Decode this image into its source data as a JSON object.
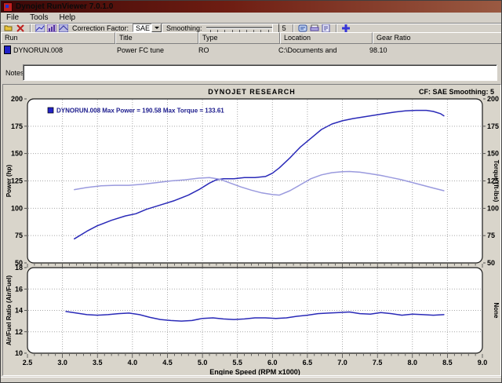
{
  "window": {
    "title": "Dynojet RunViewer 7.0.1.0"
  },
  "menu": {
    "items": [
      "File",
      "Tools",
      "Help"
    ]
  },
  "toolbar": {
    "correction_factor_label": "Correction Factor:",
    "correction_factor_value": "SAE",
    "smoothing_label": "Smoothing:",
    "smoothing_value": "5",
    "icons": [
      "open-run-icon",
      "close-run-icon",
      "graph-power-icon",
      "graph-overlay-icon",
      "graph-setup-icon",
      "notes-icon",
      "print-icon",
      "report-icon",
      "overlay-add-icon"
    ]
  },
  "run_table": {
    "columns": [
      "Run",
      "Title",
      "Type",
      "Location",
      "Gear Ratio"
    ],
    "rows": [
      {
        "run": "DYNORUN.008",
        "title": "Power FC tune",
        "type": "RO",
        "location": "C:\\Documents and",
        "gear_ratio": "98.10"
      }
    ]
  },
  "notes": {
    "label": "Notes:",
    "value": ""
  },
  "chart": {
    "header_center": "DYNOJET RESEARCH",
    "header_right": "CF: SAE  Smoothing: 5",
    "legend": {
      "swatch_color": "#2222c8",
      "text": "DYNORUN.008 Max Power = 190.58 Max Torque = 133.61"
    }
  },
  "colors": {
    "power_curve": "#2a2ab8",
    "torque_curve": "#9a9ade",
    "afr_curve": "#2a2ab8",
    "grid": "#a8a8a8",
    "legend_text": "#1a1a8c"
  },
  "chart_data": [
    {
      "type": "line",
      "title": "DYNOJET RESEARCH",
      "xlabel": "Engine Speed (RPM x1000)",
      "ylabel_left": "Power (hp)",
      "ylabel_right": "Torque (ft-lbs)",
      "xlim": [
        2.5,
        9.0
      ],
      "ylim": [
        50,
        200
      ],
      "xticks": [
        2.5,
        3.0,
        3.5,
        4.0,
        4.5,
        5.0,
        5.5,
        6.0,
        6.5,
        7.0,
        7.5,
        8.0,
        8.5,
        9.0
      ],
      "yticks": [
        50,
        75,
        100,
        125,
        150,
        175,
        200
      ],
      "grid": true,
      "legend_position": "top-left",
      "annotations": [
        "DYNORUN.008 Max Power = 190.58 Max Torque = 133.61"
      ],
      "series": [
        {
          "name": "Power (hp)",
          "color": "#2a2ab8",
          "points": [
            [
              3.17,
              72
            ],
            [
              3.35,
              79
            ],
            [
              3.5,
              84
            ],
            [
              3.7,
              89
            ],
            [
              3.9,
              93
            ],
            [
              4.05,
              95
            ],
            [
              4.2,
              99
            ],
            [
              4.4,
              103
            ],
            [
              4.6,
              107
            ],
            [
              4.8,
              112
            ],
            [
              4.95,
              117
            ],
            [
              5.1,
              123
            ],
            [
              5.2,
              126
            ],
            [
              5.3,
              127
            ],
            [
              5.45,
              127
            ],
            [
              5.6,
              128
            ],
            [
              5.75,
              128
            ],
            [
              5.9,
              129
            ],
            [
              6.0,
              132
            ],
            [
              6.1,
              137
            ],
            [
              6.25,
              146
            ],
            [
              6.4,
              156
            ],
            [
              6.55,
              164
            ],
            [
              6.7,
              172
            ],
            [
              6.85,
              177
            ],
            [
              7.0,
              180
            ],
            [
              7.15,
              182
            ],
            [
              7.3,
              183.5
            ],
            [
              7.45,
              185
            ],
            [
              7.6,
              186.5
            ],
            [
              7.75,
              188
            ],
            [
              7.9,
              189
            ],
            [
              8.05,
              189.5
            ],
            [
              8.2,
              189.5
            ],
            [
              8.3,
              188.5
            ],
            [
              8.4,
              186.5
            ],
            [
              8.45,
              184.5
            ]
          ]
        },
        {
          "name": "Torque (ft-lbs)",
          "color": "#9a9ade",
          "points": [
            [
              3.17,
              117
            ],
            [
              3.35,
              119
            ],
            [
              3.55,
              120.5
            ],
            [
              3.75,
              121
            ],
            [
              3.95,
              121
            ],
            [
              4.15,
              122
            ],
            [
              4.35,
              123.5
            ],
            [
              4.55,
              125
            ],
            [
              4.75,
              126
            ],
            [
              4.95,
              127.5
            ],
            [
              5.1,
              128
            ],
            [
              5.25,
              126.5
            ],
            [
              5.4,
              123
            ],
            [
              5.55,
              119.5
            ],
            [
              5.7,
              116.5
            ],
            [
              5.85,
              114
            ],
            [
              6.0,
              112.5
            ],
            [
              6.1,
              112
            ],
            [
              6.25,
              116
            ],
            [
              6.4,
              121.5
            ],
            [
              6.55,
              127
            ],
            [
              6.7,
              130.5
            ],
            [
              6.85,
              132.5
            ],
            [
              7.0,
              133.5
            ],
            [
              7.1,
              133.6
            ],
            [
              7.25,
              133
            ],
            [
              7.4,
              131.5
            ],
            [
              7.55,
              130
            ],
            [
              7.7,
              128
            ],
            [
              7.85,
              126
            ],
            [
              8.0,
              123.5
            ],
            [
              8.15,
              121
            ],
            [
              8.3,
              118.5
            ],
            [
              8.45,
              116
            ]
          ]
        }
      ]
    },
    {
      "type": "line",
      "title": "",
      "xlabel": "Engine Speed (RPM x1000)",
      "ylabel_left": "Air/Fuel Ratio (Air/Fuel)",
      "ylabel_right": "None",
      "xlim": [
        2.5,
        9.0
      ],
      "ylim": [
        10,
        18
      ],
      "xticks": [
        2.5,
        3.0,
        3.5,
        4.0,
        4.5,
        5.0,
        5.5,
        6.0,
        6.5,
        7.0,
        7.5,
        8.0,
        8.5,
        9.0
      ],
      "yticks": [
        10,
        12,
        14,
        16,
        18
      ],
      "grid": true,
      "series": [
        {
          "name": "Air/Fuel Ratio",
          "color": "#2a2ab8",
          "points": [
            [
              3.05,
              13.9
            ],
            [
              3.2,
              13.75
            ],
            [
              3.35,
              13.6
            ],
            [
              3.5,
              13.55
            ],
            [
              3.65,
              13.6
            ],
            [
              3.8,
              13.7
            ],
            [
              3.95,
              13.75
            ],
            [
              4.1,
              13.6
            ],
            [
              4.25,
              13.35
            ],
            [
              4.4,
              13.15
            ],
            [
              4.55,
              13.05
            ],
            [
              4.7,
              13.0
            ],
            [
              4.85,
              13.05
            ],
            [
              5.0,
              13.25
            ],
            [
              5.15,
              13.3
            ],
            [
              5.3,
              13.2
            ],
            [
              5.45,
              13.15
            ],
            [
              5.6,
              13.2
            ],
            [
              5.75,
              13.3
            ],
            [
              5.9,
              13.3
            ],
            [
              6.05,
              13.25
            ],
            [
              6.2,
              13.3
            ],
            [
              6.35,
              13.45
            ],
            [
              6.5,
              13.55
            ],
            [
              6.65,
              13.7
            ],
            [
              6.8,
              13.75
            ],
            [
              6.95,
              13.8
            ],
            [
              7.1,
              13.85
            ],
            [
              7.25,
              13.7
            ],
            [
              7.4,
              13.65
            ],
            [
              7.55,
              13.8
            ],
            [
              7.7,
              13.7
            ],
            [
              7.85,
              13.55
            ],
            [
              8.0,
              13.65
            ],
            [
              8.15,
              13.6
            ],
            [
              8.3,
              13.55
            ],
            [
              8.45,
              13.6
            ]
          ]
        }
      ]
    }
  ]
}
